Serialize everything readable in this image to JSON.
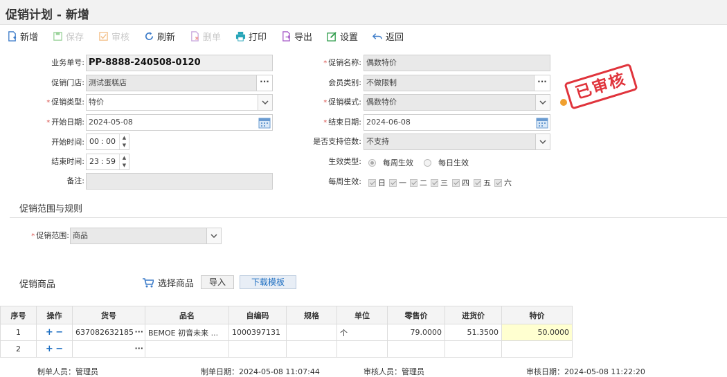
{
  "page_title": "促销计划 - 新增",
  "toolbar": {
    "new": "新增",
    "save": "保存",
    "audit": "审核",
    "refresh": "刷新",
    "delete": "删单",
    "print": "打印",
    "export": "导出",
    "settings": "设置",
    "back": "返回"
  },
  "form": {
    "order_no": {
      "label": "业务单号:",
      "value": "PP-8888-240508-0120"
    },
    "store": {
      "label": "促销门店:",
      "value": "测试蛋糕店"
    },
    "promo_type": {
      "label": "促销类型:",
      "value": "特价"
    },
    "start_date": {
      "label": "开始日期:",
      "value": "2024-05-08"
    },
    "start_time": {
      "label": "开始时间:",
      "hour": "00",
      "minute": "00"
    },
    "end_time": {
      "label": "结束时间:",
      "hour": "23",
      "minute": "59"
    },
    "remark": {
      "label": "备注:",
      "value": ""
    },
    "promo_name": {
      "label": "促销名称:",
      "value": "偶数特价"
    },
    "member_type": {
      "label": "会员类别:",
      "value": "不做限制"
    },
    "promo_mode": {
      "label": "促销模式:",
      "value": "偶数特价"
    },
    "end_date": {
      "label": "结束日期:",
      "value": "2024-06-08"
    },
    "multiple": {
      "label": "是否支持倍数:",
      "value": "不支持"
    },
    "effect_type": {
      "label": "生效类型:",
      "option1": "每周生效",
      "option2": "每日生效"
    },
    "weekly": {
      "label": "每周生效:",
      "days": [
        "日",
        "一",
        "二",
        "三",
        "四",
        "五",
        "六"
      ]
    }
  },
  "stamp": "已审核",
  "scope_section": {
    "title": "促销范围与规则",
    "label": "促销范围:",
    "value": "商品"
  },
  "goods_section": {
    "title": "促销商品",
    "select": "选择商品",
    "import": "导入",
    "download": "下载模板"
  },
  "table": {
    "headers": [
      "序号",
      "操作",
      "货号",
      "品名",
      "自编码",
      "规格",
      "单位",
      "零售价",
      "进货价",
      "特价"
    ],
    "rows": [
      {
        "no": "1",
        "code": "637082632185",
        "name": "BEMOE 初音未来 ...",
        "self_code": "1000397131",
        "spec": "",
        "unit": "个",
        "retail": "79.0000",
        "purchase": "51.3500",
        "special": "50.0000"
      },
      {
        "no": "2",
        "code": "",
        "name": "",
        "self_code": "",
        "spec": "",
        "unit": "",
        "retail": "",
        "purchase": "",
        "special": ""
      }
    ]
  },
  "footer": {
    "maker": "制单人员：管理员",
    "make_date": "制单日期：2024-05-08 11:07:44",
    "auditor": "审核人员：管理员",
    "audit_date": "审核日期：2024-05-08 11:22:20"
  },
  "colors": {
    "accent": "#1e6fc2",
    "stamp": "#e0343c",
    "required": "#d9534f"
  }
}
